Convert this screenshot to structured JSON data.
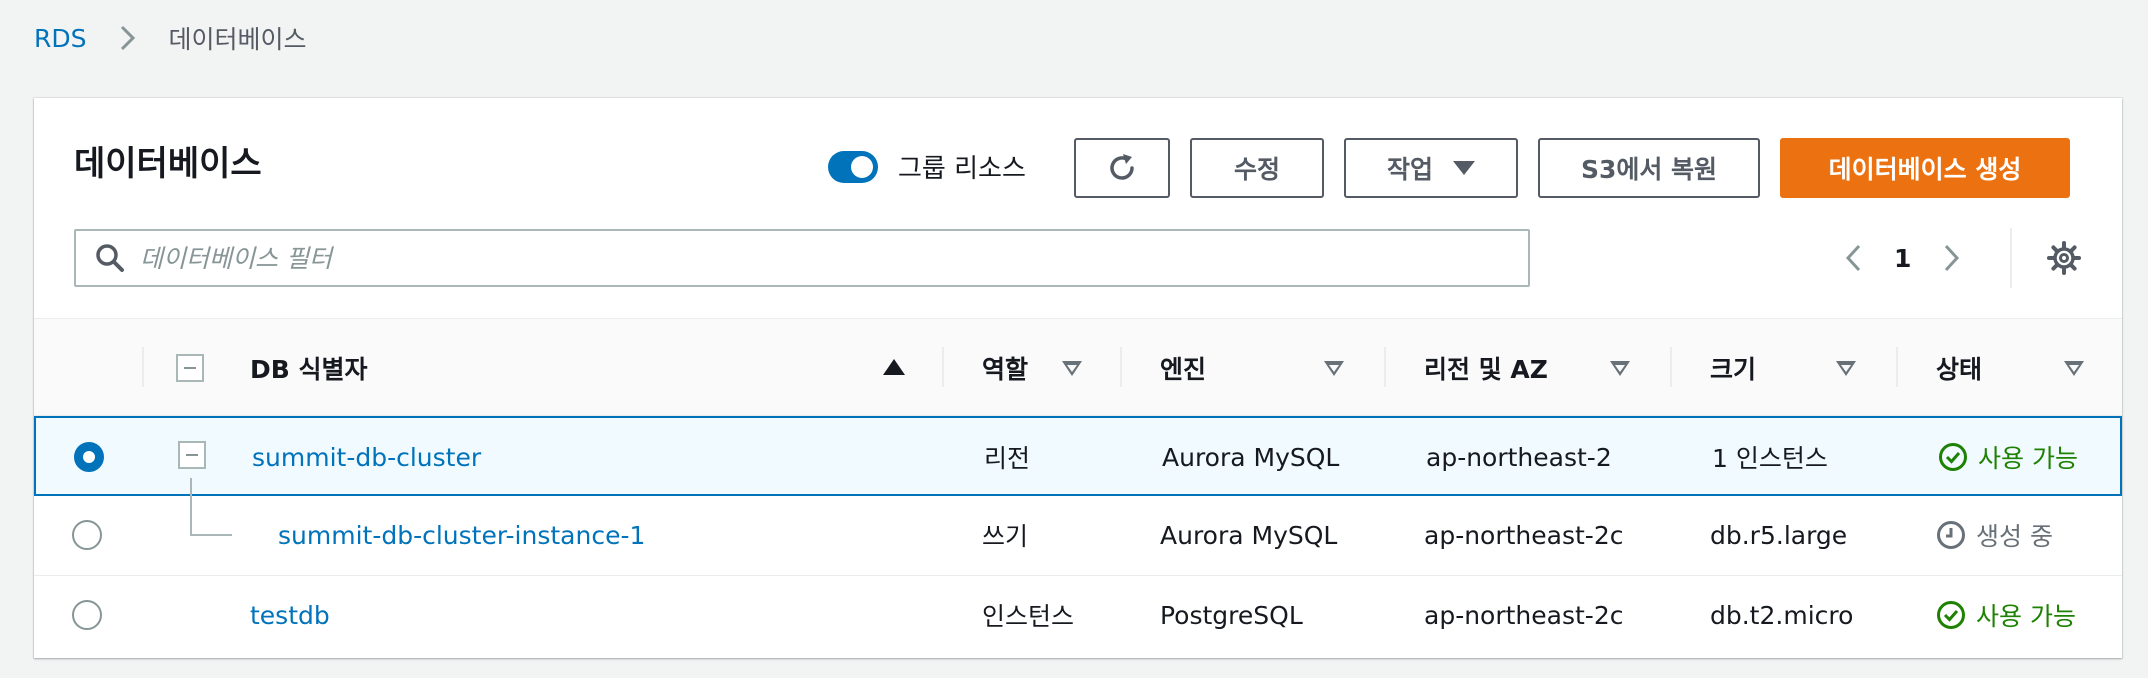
{
  "breadcrumb": {
    "root": "RDS",
    "current": "데이터베이스"
  },
  "panel": {
    "title": "데이터베이스",
    "group_toggle_label": "그룹 리소스",
    "buttons": {
      "modify": "수정",
      "actions": "작업",
      "restore_s3": "S3에서 복원",
      "create": "데이터베이스 생성"
    },
    "search_placeholder": "데이터베이스 필터",
    "page": "1"
  },
  "table": {
    "columns": {
      "identifier": "DB 식별자",
      "role": "역할",
      "engine": "엔진",
      "region": "리전 및 AZ",
      "size": "크기",
      "status": "상태"
    },
    "rows": [
      {
        "identifier": "summit-db-cluster",
        "role": "리전",
        "engine": "Aurora MySQL",
        "region": "ap-northeast-2",
        "size": "1 인스턴스",
        "status": "사용 가능",
        "status_type": "ok",
        "selected": true
      },
      {
        "identifier": "summit-db-cluster-instance-1",
        "role": "쓰기",
        "engine": "Aurora MySQL",
        "region": "ap-northeast-2c",
        "size": "db.r5.large",
        "status": "생성 중",
        "status_type": "pending",
        "selected": false
      },
      {
        "identifier": "testdb",
        "role": "인스턴스",
        "engine": "PostgreSQL",
        "region": "ap-northeast-2c",
        "size": "db.t2.micro",
        "status": "사용 가능",
        "status_type": "ok",
        "selected": false
      }
    ]
  },
  "colors": {
    "link": "#0073bb",
    "primary": "#ec7211",
    "ok": "#1d8102",
    "pending": "#687078"
  }
}
